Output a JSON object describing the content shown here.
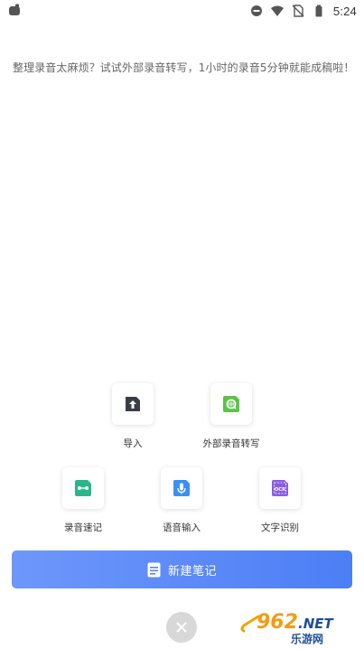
{
  "status_bar": {
    "time": "5:24",
    "icons": [
      "app-icon",
      "do-not-disturb-icon",
      "wifi-icon",
      "no-sim-icon",
      "battery-icon"
    ]
  },
  "prompt": {
    "text": "整理录音太麻烦？试试外部录音转写，1小时的录音5分钟就能成稿啦！"
  },
  "actions": [
    {
      "label": "导入",
      "icon": "import-upload-icon",
      "color": "#3a3f45"
    },
    {
      "label": "外部录音转写",
      "icon": "external-recording-transcribe-icon",
      "color": "#5cc346"
    },
    {
      "label": "录音速记",
      "icon": "recording-shorthand-icon",
      "color": "#2bb58a"
    },
    {
      "label": "语音输入",
      "icon": "microphone-icon",
      "color": "#3b8ff6"
    },
    {
      "label": "文字识别",
      "icon": "ocr-icon",
      "color": "#8a5ce6"
    }
  ],
  "new_note_button": {
    "label": "新建笔记",
    "icon": "note-icon",
    "color": "#5585f7"
  },
  "close_button": {
    "icon": "close-icon"
  },
  "watermark": {
    "text_top": "962.NET",
    "text_bottom": "乐游网"
  }
}
